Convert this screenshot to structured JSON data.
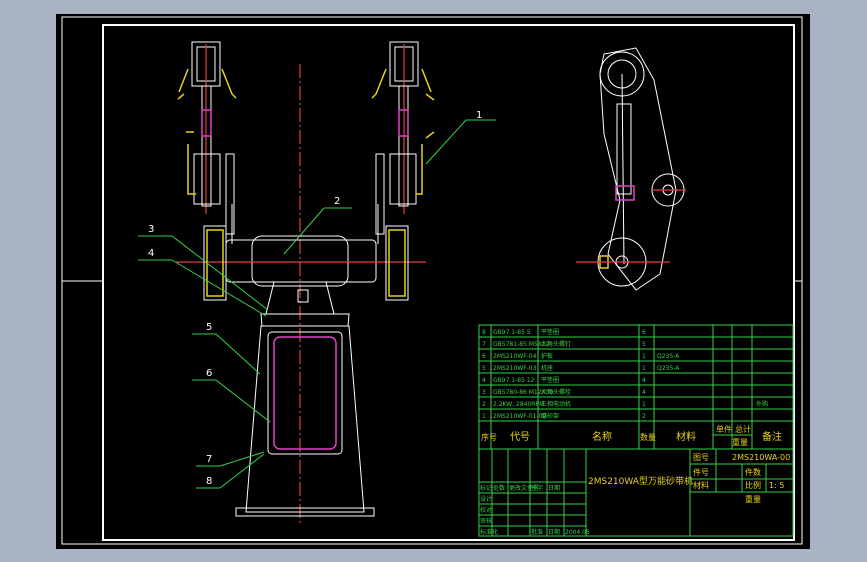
{
  "balloons": [
    "1",
    "2",
    "3",
    "4",
    "5",
    "6",
    "7",
    "8"
  ],
  "parts": [
    {
      "no": "8",
      "code": "GB97.1-85 5",
      "name": "平垫圈",
      "qty": "6",
      "material": ""
    },
    {
      "no": "7",
      "code": "GB5781-85 M5X12",
      "name": "六角头螺钉",
      "qty": "5",
      "material": ""
    },
    {
      "no": "6",
      "code": "2MS210WF-04",
      "name": "护板",
      "qty": "1",
      "material": "Q235-A"
    },
    {
      "no": "5",
      "code": "2MS210WF-03",
      "name": "机座",
      "qty": "1",
      "material": "Q235-A"
    },
    {
      "no": "4",
      "code": "GB97.1-85 12",
      "name": "平垫圈",
      "qty": "4",
      "material": ""
    },
    {
      "no": "3",
      "code": "GB5780-86 M12X30",
      "name": "六角头螺栓",
      "qty": "4",
      "material": ""
    },
    {
      "no": "2",
      "code": "2.2KW, 2840RPM",
      "name": "三相电动机",
      "qty": "1",
      "material": "",
      "note": "外购"
    },
    {
      "no": "1",
      "code": "2MS210WF-01-00",
      "name": "磨砂架",
      "qty": "2",
      "material": ""
    }
  ],
  "header": {
    "no": "序号",
    "code": "代号",
    "name": "名称",
    "qty": "数量",
    "material": "材料",
    "single": "单件",
    "total": "总计",
    "weight": "重量",
    "note": "备注"
  },
  "title_block": {
    "drawing_title": "2MS210WA型万能砂带机",
    "drawing_code_label": "图号",
    "drawing_code": "2MS210WA-00",
    "part_no_label": "件号",
    "count_label": "件数",
    "scale_label": "比例",
    "scale": "1: 5",
    "material_label": "材料",
    "weight_label": "重量",
    "rows": [
      "标记",
      "处数",
      "更改文件号",
      "签字",
      "日期"
    ],
    "designer": "设计",
    "checker": "校对",
    "reviewer": "审核",
    "approver": "批准",
    "stdcheck": "标准化",
    "date_label": "日期",
    "date": "2004.05"
  }
}
